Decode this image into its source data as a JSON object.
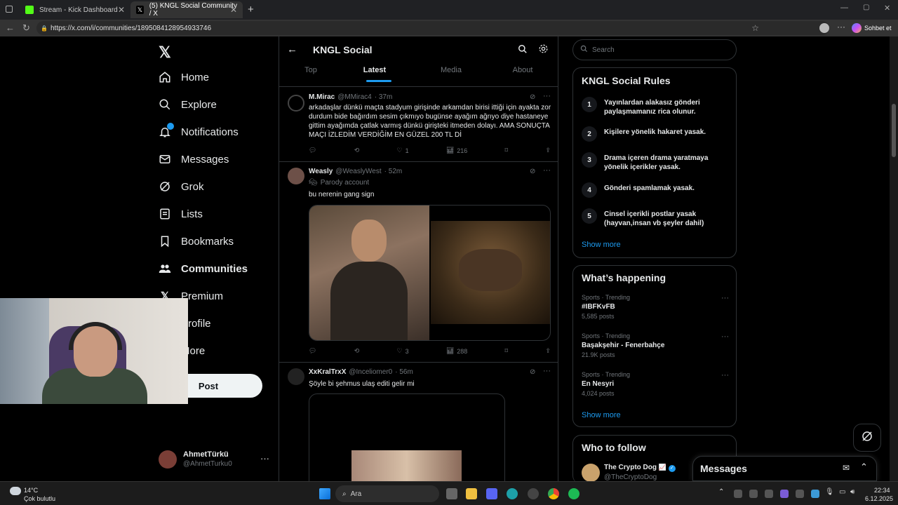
{
  "browser": {
    "tabs": [
      {
        "title": "Stream - Kick Dashboard"
      },
      {
        "title": "(5) KNGL Social Community / X"
      }
    ],
    "url": "https://x.com/i/communities/1895084128954933746",
    "profile_label": "Sohbet et"
  },
  "nav": {
    "items": [
      {
        "label": "Home"
      },
      {
        "label": "Explore"
      },
      {
        "label": "Notifications"
      },
      {
        "label": "Messages"
      },
      {
        "label": "Grok"
      },
      {
        "label": "Lists"
      },
      {
        "label": "Bookmarks"
      },
      {
        "label": "Communities"
      },
      {
        "label": "Premium"
      },
      {
        "label": "Profile"
      },
      {
        "label": "More"
      }
    ],
    "post_label": "Post",
    "user": {
      "name": "AhmetTürkü",
      "handle": "@AhmetTurku0"
    }
  },
  "header": {
    "title": "KNGL Social",
    "tabs": [
      "Top",
      "Latest",
      "Media",
      "About"
    ]
  },
  "tweets": [
    {
      "name": "M.Mirac",
      "handle": "@MMirac4",
      "time": "· 37m",
      "text": "arkadaşlar dünkü maçta stadyum girişinde arkamdan birisi ittiği için ayakta zor durdum bide bağırdım sesim çıkmıyo bugünse ayağım ağrıyo diye hastaneye gittim ayağımda çatlak varmış dünkü girişteki itmeden dolayı. AMA SONUÇTA MAÇI İZLEDİM VERDİĞİM EN GÜZEL 200 TL Dİ",
      "likes": "1",
      "views": "216"
    },
    {
      "name": "Weasly",
      "handle": "@WeaslyWest",
      "time": "· 52m",
      "badge": "Parody account",
      "text": "bu nerenin gang sign",
      "likes": "3",
      "views": "288"
    },
    {
      "name": "XxKralTrxX",
      "handle": "@Inceliomer0",
      "time": "· 56m",
      "text": "Şöyle bi şehmus ulaş editi gelir mi"
    }
  ],
  "search": {
    "placeholder": "Search"
  },
  "rules": {
    "title": "KNGL Social Rules",
    "items": [
      {
        "num": "1",
        "text": "Yayınlardan alakasız gönderi paylaşmamanız rica olunur."
      },
      {
        "num": "2",
        "text": "Kişilere yönelik hakaret yasak."
      },
      {
        "num": "3",
        "text": "Drama içeren drama yaratmaya yönelik içerikler yasak."
      },
      {
        "num": "4",
        "text": "Gönderi spamlamak yasak."
      },
      {
        "num": "5",
        "text": "Cinsel içerikli postlar yasak (hayvan,insan vb şeyler dahil)"
      }
    ],
    "show_more": "Show more"
  },
  "happening": {
    "title": "What’s happening",
    "trends": [
      {
        "category": "Sports · Trending",
        "name": "#IBFKvFB",
        "count": "5,585 posts"
      },
      {
        "category": "Sports · Trending",
        "name": "Başakşehir - Fenerbahçe",
        "count": "21.9K posts"
      },
      {
        "category": "Sports · Trending",
        "name": "En Nesyri",
        "count": "4,024 posts"
      }
    ],
    "show_more": "Show more"
  },
  "follow": {
    "title": "Who to follow",
    "name": "The Crypto Dog",
    "handle": "@TheCryptoDog"
  },
  "messages_drawer": {
    "title": "Messages"
  },
  "taskbar": {
    "weather_temp": "14°C",
    "weather_desc": "Çok bulutlu",
    "search": "Ara",
    "time": "22:34",
    "date": "6.12.2025"
  },
  "colors": {
    "accent": "#1d9bf0",
    "background": "#000000",
    "border": "#2f3336"
  }
}
